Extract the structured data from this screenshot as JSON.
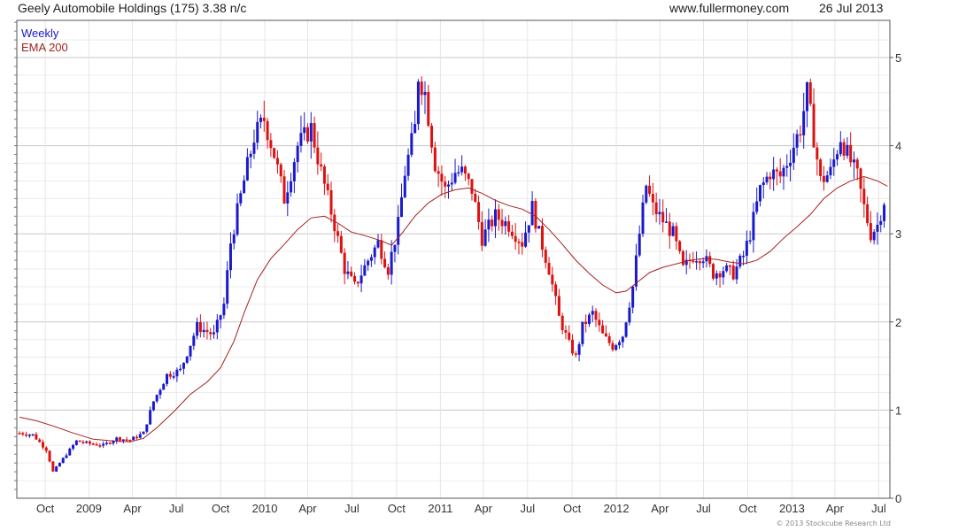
{
  "header": {
    "title": "Geely Automobile Holdings (175) 3.38 n/c",
    "site": "www.fullermoney.com",
    "date": "26 Jul 2013"
  },
  "legend": {
    "weekly": "Weekly",
    "ema": "EMA 200"
  },
  "copyright": "© 2013 Stockcube Research Ltd",
  "colors": {
    "up": "#1a1acc",
    "down": "#dd1111",
    "ema": "#a52020",
    "grid": "#d9d9d9",
    "frame": "#555555"
  },
  "chart_data": {
    "type": "candlestick",
    "title": "Geely Automobile Holdings (175) 3.38 n/c",
    "ylim": [
      0,
      5.4
    ],
    "y_ticks": [
      0,
      1,
      2,
      3,
      4,
      5
    ],
    "x_ticks": [
      {
        "label": "Oct",
        "t": 7.7
      },
      {
        "label": "2009",
        "t": 20.7
      },
      {
        "label": "Apr",
        "t": 33.7
      },
      {
        "label": "Jul",
        "t": 46.8
      },
      {
        "label": "Oct",
        "t": 60.0
      },
      {
        "label": "2010",
        "t": 73.2
      },
      {
        "label": "Apr",
        "t": 86.0
      },
      {
        "label": "Jul",
        "t": 99.2
      },
      {
        "label": "Oct",
        "t": 112.5
      },
      {
        "label": "2011",
        "t": 125.6
      },
      {
        "label": "Apr",
        "t": 138.4
      },
      {
        "label": "Jul",
        "t": 151.6
      },
      {
        "label": "Oct",
        "t": 164.9
      },
      {
        "label": "2012",
        "t": 178.1
      },
      {
        "label": "Apr",
        "t": 191.1
      },
      {
        "label": "Jul",
        "t": 204.1
      },
      {
        "label": "Oct",
        "t": 217.3
      },
      {
        "label": "2013",
        "t": 230.5
      },
      {
        "label": "Apr",
        "t": 243.3
      },
      {
        "label": "Jul",
        "t": 256.4
      }
    ],
    "price_path": [
      [
        0,
        0.74
      ],
      [
        4,
        0.72
      ],
      [
        8,
        0.55
      ],
      [
        10,
        0.3
      ],
      [
        13,
        0.45
      ],
      [
        17,
        0.65
      ],
      [
        21,
        0.62
      ],
      [
        25,
        0.6
      ],
      [
        29,
        0.68
      ],
      [
        33,
        0.66
      ],
      [
        37,
        0.74
      ],
      [
        40,
        1.1
      ],
      [
        44,
        1.4
      ],
      [
        48,
        1.45
      ],
      [
        53,
        1.95
      ],
      [
        58,
        1.85
      ],
      [
        61,
        2.2
      ],
      [
        63,
        2.9
      ],
      [
        67,
        3.6
      ],
      [
        70,
        4.1
      ],
      [
        73,
        4.3
      ],
      [
        76,
        3.9
      ],
      [
        79,
        3.4
      ],
      [
        83,
        4.0
      ],
      [
        87,
        4.2
      ],
      [
        90,
        3.7
      ],
      [
        94,
        3.1
      ],
      [
        97,
        2.6
      ],
      [
        100,
        2.4
      ],
      [
        104,
        2.7
      ],
      [
        107,
        2.9
      ],
      [
        110,
        2.6
      ],
      [
        113,
        3.1
      ],
      [
        115,
        3.7
      ],
      [
        118,
        4.2
      ],
      [
        119,
        4.8
      ],
      [
        121,
        4.6
      ],
      [
        124,
        3.8
      ],
      [
        127,
        3.5
      ],
      [
        130,
        3.7
      ],
      [
        132,
        3.7
      ],
      [
        135,
        3.5
      ],
      [
        138,
        2.95
      ],
      [
        142,
        3.2
      ],
      [
        146,
        3.1
      ],
      [
        150,
        2.9
      ],
      [
        153,
        3.3
      ],
      [
        155,
        3.0
      ],
      [
        158,
        2.6
      ],
      [
        161,
        2.05
      ],
      [
        164,
        1.75
      ],
      [
        166,
        1.6
      ],
      [
        168,
        1.95
      ],
      [
        171,
        2.1
      ],
      [
        174,
        1.85
      ],
      [
        177,
        1.72
      ],
      [
        180,
        1.85
      ],
      [
        183,
        2.4
      ],
      [
        185,
        3.0
      ],
      [
        187,
        3.55
      ],
      [
        189,
        3.3
      ],
      [
        192,
        3.15
      ],
      [
        195,
        3.0
      ],
      [
        198,
        2.6
      ],
      [
        201,
        2.75
      ],
      [
        204,
        2.75
      ],
      [
        207,
        2.55
      ],
      [
        210,
        2.6
      ],
      [
        213,
        2.55
      ],
      [
        216,
        2.75
      ],
      [
        218,
        3.0
      ],
      [
        221,
        3.5
      ],
      [
        224,
        3.7
      ],
      [
        227,
        3.65
      ],
      [
        230,
        3.9
      ],
      [
        233,
        4.2
      ],
      [
        235,
        4.6
      ],
      [
        237,
        4.1
      ],
      [
        239,
        3.6
      ],
      [
        242,
        3.7
      ],
      [
        245,
        4.1
      ],
      [
        247,
        3.9
      ],
      [
        250,
        3.65
      ],
      [
        252,
        3.3
      ],
      [
        254,
        3.0
      ],
      [
        256,
        3.1
      ],
      [
        258,
        3.38
      ]
    ],
    "ema_path": [
      [
        0,
        0.92
      ],
      [
        5,
        0.88
      ],
      [
        10,
        0.82
      ],
      [
        16,
        0.74
      ],
      [
        22,
        0.67
      ],
      [
        28,
        0.65
      ],
      [
        33,
        0.64
      ],
      [
        37,
        0.68
      ],
      [
        41,
        0.8
      ],
      [
        46,
        0.98
      ],
      [
        51,
        1.18
      ],
      [
        56,
        1.32
      ],
      [
        60,
        1.48
      ],
      [
        64,
        1.78
      ],
      [
        67,
        2.1
      ],
      [
        71,
        2.48
      ],
      [
        75,
        2.72
      ],
      [
        79,
        2.88
      ],
      [
        83,
        3.05
      ],
      [
        87,
        3.18
      ],
      [
        91,
        3.2
      ],
      [
        95,
        3.12
      ],
      [
        99,
        3.02
      ],
      [
        103,
        2.98
      ],
      [
        108,
        2.92
      ],
      [
        111,
        2.87
      ],
      [
        114,
        3.0
      ],
      [
        118,
        3.2
      ],
      [
        122,
        3.35
      ],
      [
        126,
        3.45
      ],
      [
        130,
        3.5
      ],
      [
        134,
        3.52
      ],
      [
        138,
        3.46
      ],
      [
        142,
        3.38
      ],
      [
        146,
        3.32
      ],
      [
        150,
        3.28
      ],
      [
        154,
        3.2
      ],
      [
        158,
        3.05
      ],
      [
        162,
        2.88
      ],
      [
        166,
        2.7
      ],
      [
        170,
        2.55
      ],
      [
        174,
        2.42
      ],
      [
        178,
        2.33
      ],
      [
        181,
        2.35
      ],
      [
        184,
        2.44
      ],
      [
        188,
        2.56
      ],
      [
        192,
        2.62
      ],
      [
        196,
        2.66
      ],
      [
        200,
        2.7
      ],
      [
        204,
        2.72
      ],
      [
        208,
        2.71
      ],
      [
        212,
        2.68
      ],
      [
        216,
        2.66
      ],
      [
        220,
        2.7
      ],
      [
        224,
        2.8
      ],
      [
        228,
        2.95
      ],
      [
        232,
        3.08
      ],
      [
        236,
        3.22
      ],
      [
        240,
        3.4
      ],
      [
        244,
        3.52
      ],
      [
        248,
        3.6
      ],
      [
        252,
        3.65
      ],
      [
        256,
        3.6
      ],
      [
        259,
        3.54
      ]
    ]
  }
}
